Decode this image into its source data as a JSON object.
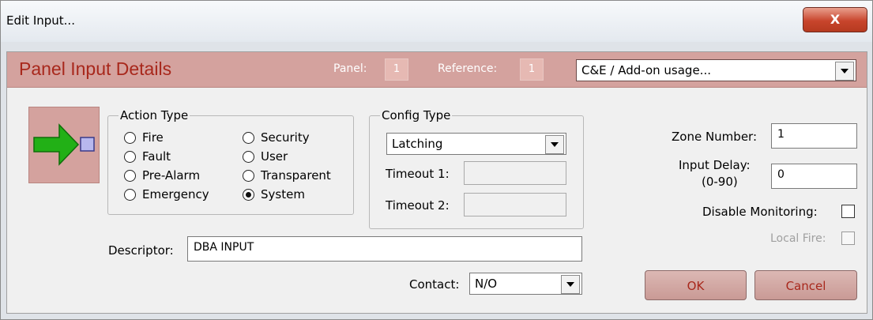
{
  "window": {
    "title": "Edit Input..."
  },
  "header": {
    "title": "Panel Input Details",
    "panel_label": "Panel:",
    "panel_value": "1",
    "reference_label": "Reference:",
    "reference_value": "1",
    "usage_select": {
      "value": "C&E / Add-on usage..."
    }
  },
  "colors": {
    "header_bg": "#d4a29e",
    "title_red": "#a8281c",
    "arrow_green": "#22b016",
    "square_purple": "#b8b8ee"
  },
  "action_type": {
    "label": "Action Type",
    "options": [
      {
        "label": "Fire",
        "selected": false
      },
      {
        "label": "Fault",
        "selected": false
      },
      {
        "label": "Pre-Alarm",
        "selected": false
      },
      {
        "label": "Emergency",
        "selected": false
      },
      {
        "label": "Security",
        "selected": false
      },
      {
        "label": "User",
        "selected": false
      },
      {
        "label": "Transparent",
        "selected": false
      },
      {
        "label": "System",
        "selected": true
      }
    ]
  },
  "config_type": {
    "label": "Config Type",
    "select_value": "Latching",
    "timeout1_label": "Timeout 1:",
    "timeout1_value": "",
    "timeout2_label": "Timeout 2:",
    "timeout2_value": ""
  },
  "zone": {
    "label": "Zone Number:",
    "value": "1"
  },
  "input_delay": {
    "label": "Input Delay:",
    "range": "(0-90)",
    "value": "0"
  },
  "disable_monitoring": {
    "label": "Disable Monitoring:",
    "checked": false
  },
  "local_fire": {
    "label": "Local Fire:",
    "checked": false,
    "disabled": true
  },
  "descriptor": {
    "label": "Descriptor:",
    "value": "DBA INPUT"
  },
  "contact": {
    "label": "Contact:",
    "value": "N/O"
  },
  "buttons": {
    "ok": "OK",
    "cancel": "Cancel",
    "close": "X"
  }
}
